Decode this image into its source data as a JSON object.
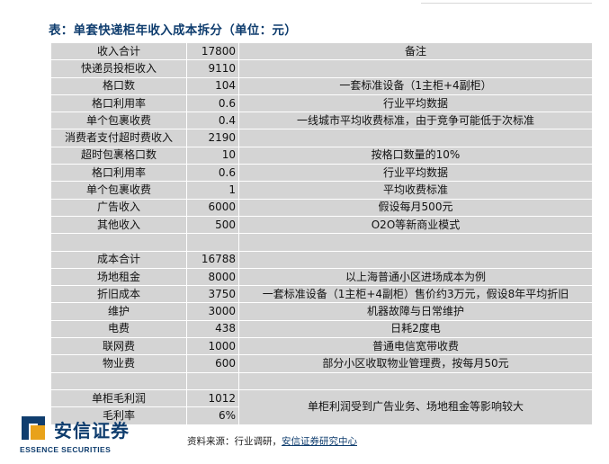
{
  "title": "表：单套快递柜年收入成本拆分（单位：元）",
  "rows": [
    {
      "label": "收入合计",
      "value": "17800",
      "note": "备注"
    },
    {
      "label": "快递员投柜收入",
      "value": "9110",
      "note": ""
    },
    {
      "label": "格口数",
      "value": "104",
      "note": "一套标准设备（1主柜+4副柜）"
    },
    {
      "label": "格口利用率",
      "value": "0.6",
      "note": "行业平均数据"
    },
    {
      "label": "单个包裹收费",
      "value": "0.4",
      "note": "一线城市平均收费标准，由于竞争可能低于次标准"
    },
    {
      "label": "消费者支付超时费收入",
      "value": "2190",
      "note": ""
    },
    {
      "label": "超时包裹格口数",
      "value": "10",
      "note": "按格口数量的10%"
    },
    {
      "label": "格口利用率",
      "value": "0.6",
      "note": "行业平均数据"
    },
    {
      "label": "单个包裹收费",
      "value": "1",
      "note": "平均收费标准"
    },
    {
      "label": "广告收入",
      "value": "6000",
      "note": "假设每月500元"
    },
    {
      "label": "其他收入",
      "value": "500",
      "note": "O2O等新商业模式"
    },
    {
      "label": "",
      "value": "",
      "note": ""
    },
    {
      "label": "成本合计",
      "value": "16788",
      "note": ""
    },
    {
      "label": "场地租金",
      "value": "8000",
      "note": "以上海普通小区进场成本为例"
    },
    {
      "label": "折旧成本",
      "value": "3750",
      "note": "一套标准设备（1主柜+4副柜）售价约3万元，假设8年平均折旧"
    },
    {
      "label": "维护",
      "value": "3000",
      "note": "机器故障与日常维护"
    },
    {
      "label": "电费",
      "value": "438",
      "note": "日耗2度电"
    },
    {
      "label": "联网费",
      "value": "1000",
      "note": "普通电信宽带收费"
    },
    {
      "label": "物业费",
      "value": "600",
      "note": "部分小区收取物业管理费，按每月50元"
    },
    {
      "label": "",
      "value": "",
      "note": ""
    }
  ],
  "margin_rows": [
    {
      "label": "单柜毛利润",
      "value": "1012"
    },
    {
      "label": "毛利率",
      "value": "6%"
    }
  ],
  "margin_note": "单柜利润受到广告业务、场地租金等影响较大",
  "logo": {
    "cn": "安信证券",
    "en": "ESSENCE SECURITIES",
    "color": "#0f3d6e",
    "accent": "#e8a21a"
  },
  "source": {
    "prefix": "资料来源：行业调研，",
    "link": "安信证券研究中心"
  }
}
